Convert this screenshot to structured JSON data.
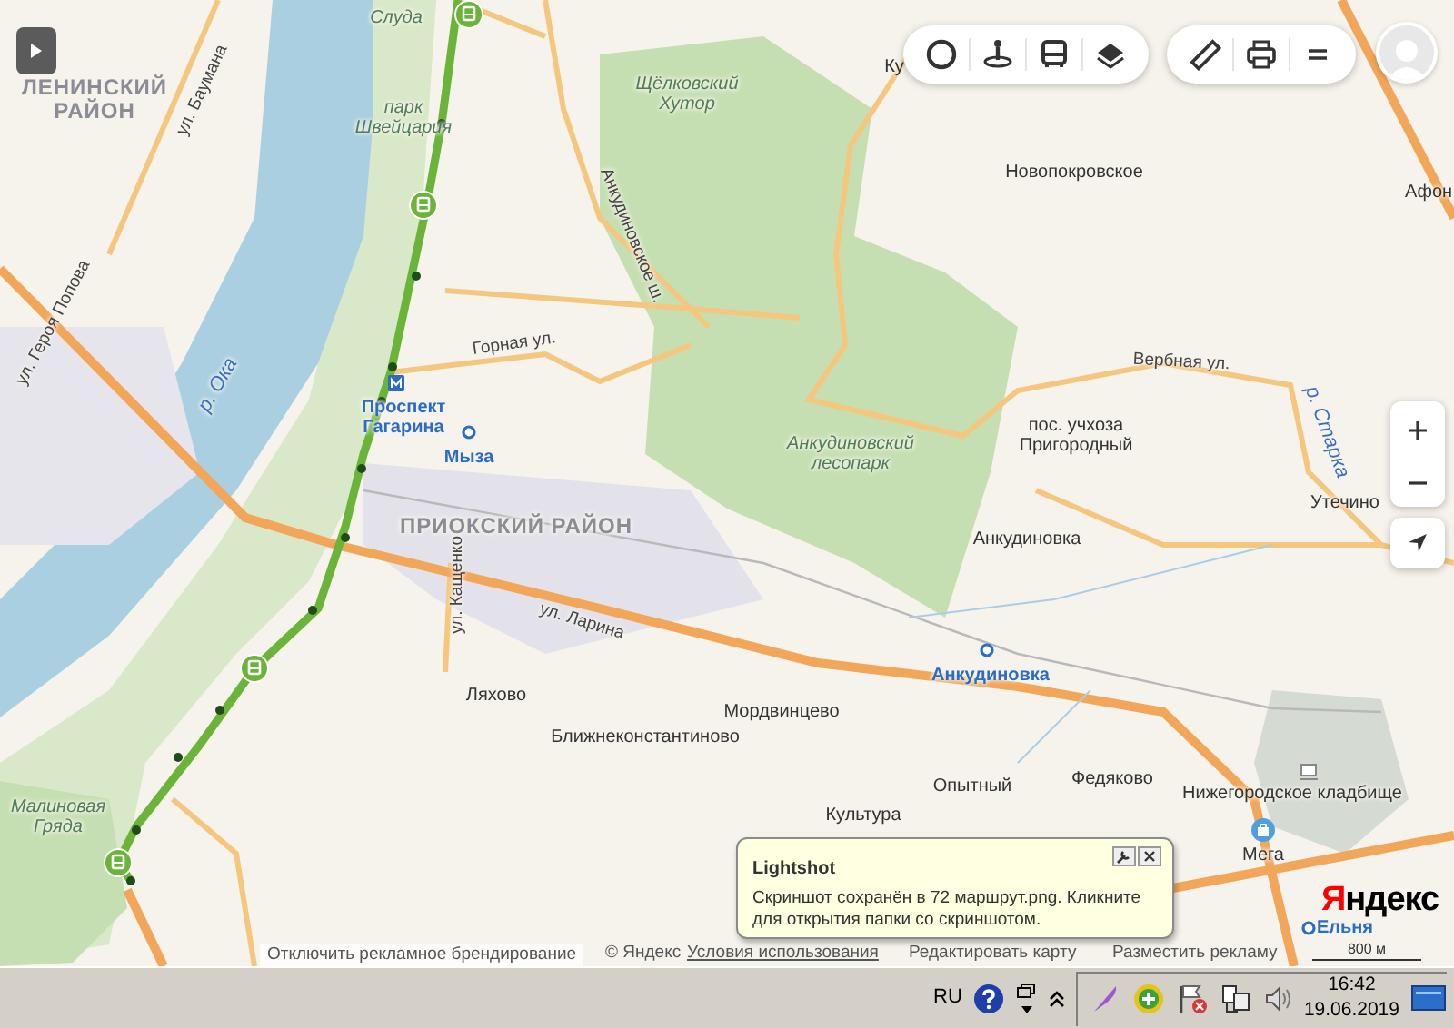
{
  "map": {
    "labels": [
      {
        "text": "ЛЕНИНСКИЙ РАЙОН",
        "kind": "district"
      },
      {
        "text": "Слуда",
        "kind": "park"
      },
      {
        "text": "ул. Баумана",
        "kind": "street"
      },
      {
        "text": "парк Швейцария",
        "kind": "park"
      },
      {
        "text": "Щёлковский Хутор",
        "kind": "park"
      },
      {
        "text": "Ку",
        "kind": "place"
      },
      {
        "text": "Новопокровское",
        "kind": "place"
      },
      {
        "text": "Афон",
        "kind": "place"
      },
      {
        "text": "Анкудиновское ш.",
        "kind": "street"
      },
      {
        "text": "ул. Героя Попова",
        "kind": "street"
      },
      {
        "text": "р. Ока",
        "kind": "water"
      },
      {
        "text": "Горная ул.",
        "kind": "street"
      },
      {
        "text": "Проспект Гагарина",
        "kind": "station"
      },
      {
        "text": "Мыза",
        "kind": "station"
      },
      {
        "text": "Вербная ул.",
        "kind": "street"
      },
      {
        "text": "пос. учхоза Пригородный",
        "kind": "place"
      },
      {
        "text": "р. Старка",
        "kind": "water"
      },
      {
        "text": "Анкудиновский лесопарк",
        "kind": "park"
      },
      {
        "text": "Утечино",
        "kind": "place"
      },
      {
        "text": "ПРИОКСКИЙ РАЙОН",
        "kind": "district"
      },
      {
        "text": "ул. Кащенко",
        "kind": "street"
      },
      {
        "text": "ул. Ларина",
        "kind": "street"
      },
      {
        "text": "Анкудиновка",
        "kind": "place"
      },
      {
        "text": "Анкудиновка",
        "kind": "station"
      },
      {
        "text": "Ляхово",
        "kind": "place"
      },
      {
        "text": "Мордвинцево",
        "kind": "place"
      },
      {
        "text": "Ближнеконстантиново",
        "kind": "place"
      },
      {
        "text": "Опытный",
        "kind": "place"
      },
      {
        "text": "Федяково",
        "kind": "place"
      },
      {
        "text": "Нижегородское кладбище",
        "kind": "place"
      },
      {
        "text": "Культура",
        "kind": "place"
      },
      {
        "text": "Мега",
        "kind": "place"
      },
      {
        "text": "Малиновая Гряда",
        "kind": "park"
      },
      {
        "text": "Ельня",
        "kind": "station"
      }
    ],
    "logo": "Яндекс",
    "scale": "800 м",
    "attribution": {
      "branding_off": "Отключить рекламное брендирование",
      "copyright": "© Яндекс",
      "terms": "Условия использования",
      "edit": "Редактировать карту",
      "advertise": "Разместить рекламу"
    }
  },
  "notification": {
    "title": "Lightshot",
    "message": "Скриншот сохранён в 72 маршрут.png. Кликните для открытия папки со скриншотом."
  },
  "taskbar": {
    "language": "RU",
    "time": "16:42",
    "date": "19.06.2019"
  }
}
